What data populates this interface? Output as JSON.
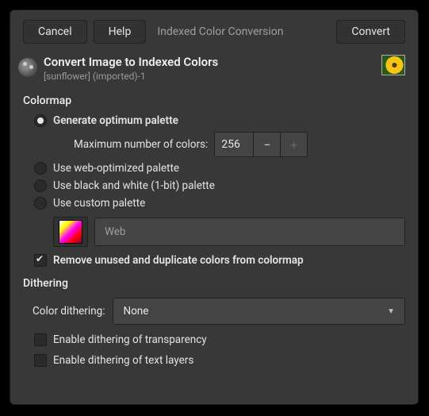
{
  "titlebar": {
    "cancel": "Cancel",
    "help": "Help",
    "title": "Indexed Color Conversion",
    "convert": "Convert"
  },
  "header": {
    "title": "Convert Image to Indexed Colors",
    "subtitle": "[sunflower] (imported)-1"
  },
  "colormap": {
    "section": "Colormap",
    "generate": "Generate optimum palette",
    "max_label": "Maximum number of colors:",
    "max_value": "256",
    "web": "Use web-optimized palette",
    "bw": "Use black and white (1-bit) palette",
    "custom": "Use custom palette",
    "palette_name": "Web",
    "remove": "Remove unused and duplicate colors from colormap"
  },
  "dithering": {
    "section": "Dithering",
    "label": "Color dithering:",
    "value": "None",
    "transparency": "Enable dithering of transparency",
    "text_layers": "Enable dithering of text layers"
  }
}
